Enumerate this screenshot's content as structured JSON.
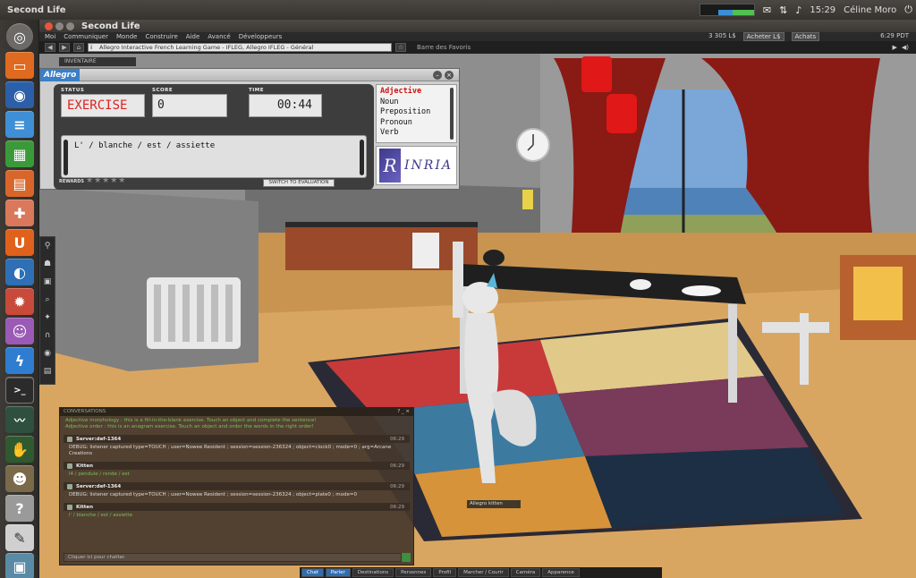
{
  "os_panel": {
    "app_name": "Second Life",
    "time": "15:29",
    "user": "Céline Moro"
  },
  "window": {
    "title": "Second Life"
  },
  "menu": {
    "items": [
      "Moi",
      "Communiquer",
      "Monde",
      "Construire",
      "Aide",
      "Avancé",
      "Développeurs"
    ],
    "balance": "3 305 L$",
    "buy_label": "Acheter L$",
    "shop_label": "Achats",
    "clock": "6:29 PDT"
  },
  "navbar": {
    "url": "Allegro Interactive French Learning Game - IFLEG, Allegro IFLEG - Général",
    "favorites": "Barre des Favoris"
  },
  "hud": {
    "inventory_tab": "INVENTAIRE",
    "logo": "Allegro",
    "status_label": "STATUS",
    "status_value": "EXERCISE",
    "score_label": "SCORE",
    "score_value": "0",
    "time_label": "TIME",
    "time_value": "00:44",
    "sentence": "L' / blanche / est / assiette",
    "rewards_label": "REWARDS",
    "stars": "★★★★★",
    "switch_button": "SWITCH TO EVALUATION",
    "categories": [
      "Adjective",
      "Noun",
      "Preposition",
      "Pronoun",
      "Verb"
    ],
    "selected_category": "Adjective",
    "sponsor_logo": "INRIA",
    "sponsor_mark": "R"
  },
  "chat": {
    "header": "CONVERSATIONS",
    "system_lines": [
      "Adjective morphology : this is a fill-in-the-blank exercise. Touch an object and complete the sentence!",
      "Adjective order : this is an anagram exercise. Touch an object and order the words in the right order!"
    ],
    "messages": [
      {
        "name": "Server:def-1364",
        "time": "06:29",
        "text": "DEBUG: listener captured type=TOUCH ; user=Nowee Resident ; session=session-236324 ; object=clock0 ; mode=0 ; arg=Arcane Creations",
        "style": "debug"
      },
      {
        "name": "Kitten",
        "time": "06:29",
        "text": "l4 / pendule / ronde / est",
        "style": "user"
      },
      {
        "name": "Server:def-1364",
        "time": "06:29",
        "text": "DEBUG: listener captured type=TOUCH ; user=Nowee Resident ; session=session-236324 ; object=plate0 ; mode=0",
        "style": "debug"
      },
      {
        "name": "Kitten",
        "time": "06:29",
        "text": "l' / blanche / est / assiette",
        "style": "user"
      }
    ],
    "input_placeholder": "Cliquer ici pour chatter."
  },
  "bottom_toolbar": [
    "Chat",
    "Parler",
    "Destinations",
    "Personnes",
    "Profil",
    "Marcher / Courir",
    "Caméra",
    "Apparence"
  ],
  "avatar_tag": "Allegro kitten",
  "colors": {
    "status_red": "#dd2222",
    "selected_category": "#cc1111",
    "chat_green": "#7bbf5b",
    "launcher_bg": "#3d3a36"
  }
}
